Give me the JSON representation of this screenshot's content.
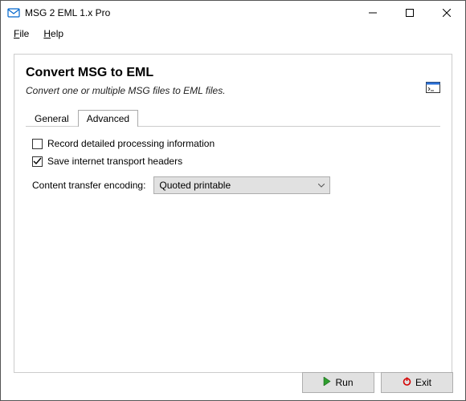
{
  "window": {
    "title": "MSG 2 EML 1.x Pro"
  },
  "menu": {
    "file": "File",
    "help": "Help"
  },
  "page": {
    "heading": "Convert MSG to EML",
    "subtitle": "Convert one or multiple MSG files to EML files."
  },
  "tabs": {
    "general": "General",
    "advanced": "Advanced"
  },
  "options": {
    "record_detail": {
      "label": "Record detailed processing information",
      "checked": false
    },
    "save_headers": {
      "label": "Save internet transport headers",
      "checked": true
    },
    "encoding_label": "Content transfer encoding:",
    "encoding_value": "Quoted printable"
  },
  "buttons": {
    "run": "Run",
    "exit": "Exit"
  }
}
